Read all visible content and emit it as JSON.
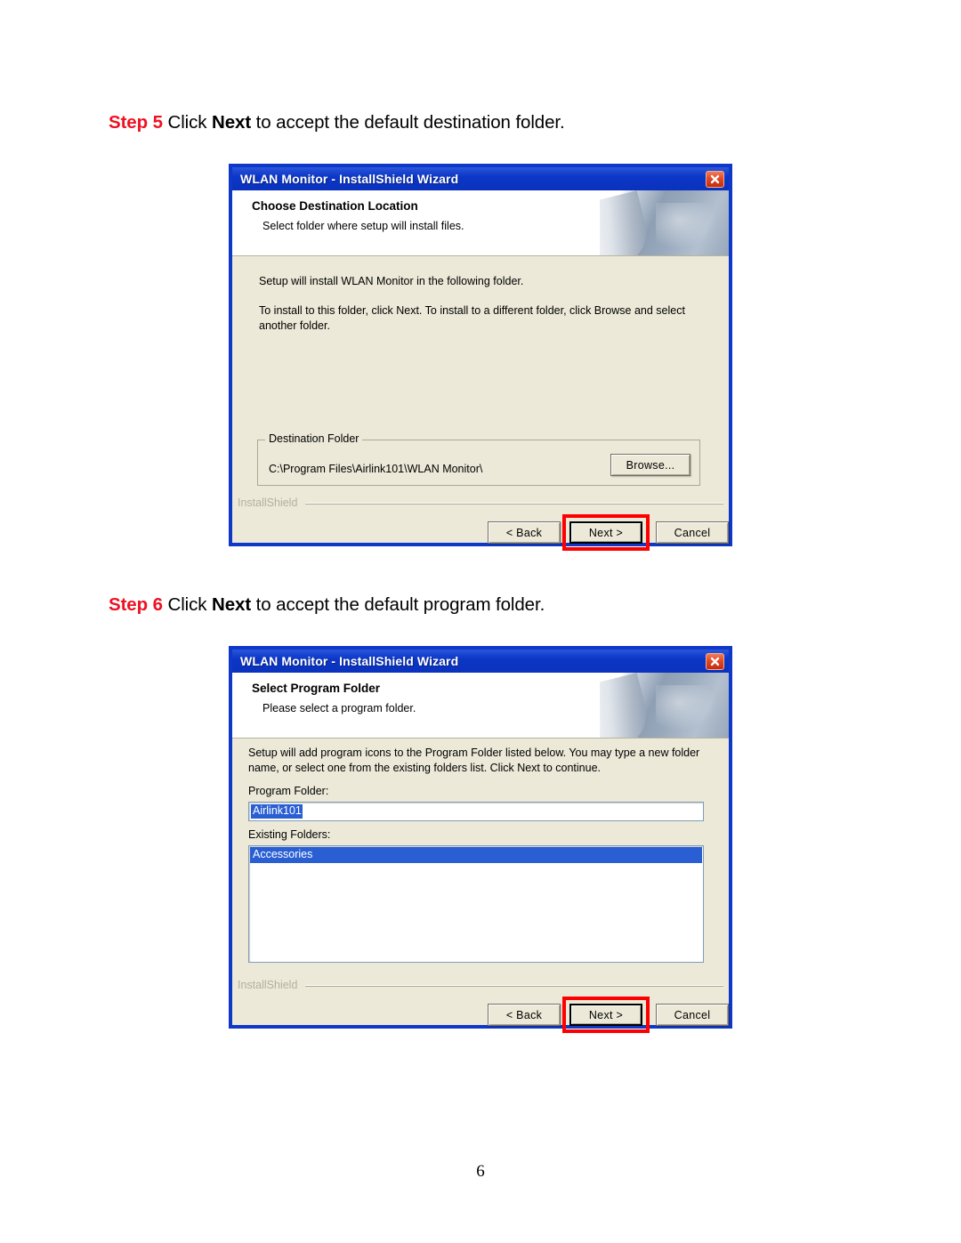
{
  "document": {
    "page_number": "6"
  },
  "steps": [
    {
      "label": "Step 5",
      "text_before": " Click ",
      "bold_word": "Next",
      "text_after": " to accept the default destination folder."
    },
    {
      "label": "Step 6",
      "text_before": " Click ",
      "bold_word": "Next",
      "text_after": " to accept the default program folder."
    }
  ],
  "dialog_destination": {
    "title": "WLAN Monitor - InstallShield Wizard",
    "close_icon": "close-icon",
    "header_title": "Choose Destination Location",
    "header_subtitle": "Select folder where setup will install files.",
    "body_paragraph_1": "Setup will install WLAN Monitor in the following folder.",
    "body_paragraph_2": "To install to this folder, click Next. To install to a different folder, click Browse and select another folder.",
    "groupbox_legend": "Destination Folder",
    "destination_path": "C:\\Program Files\\Airlink101\\WLAN Monitor\\",
    "browse_label": "Browse...",
    "installshield_label": "InstallShield",
    "back_label": "< Back",
    "next_label": "Next >",
    "cancel_label": "Cancel"
  },
  "dialog_program": {
    "title": "WLAN Monitor - InstallShield Wizard",
    "close_icon": "close-icon",
    "header_title": "Select Program Folder",
    "header_subtitle": "Please select a program folder.",
    "body_paragraph_1": "Setup will add program icons to the Program Folder listed below.  You may type a new folder name, or select one from the existing folders list.  Click Next to continue.",
    "program_folder_label": "Program Folder:",
    "program_folder_value": "Airlink101",
    "existing_folders_label": "Existing Folders:",
    "existing_folders": [
      "Accessories"
    ],
    "installshield_label": "InstallShield",
    "back_label": "< Back",
    "next_label": "Next >",
    "cancel_label": "Cancel"
  },
  "colors": {
    "step_label": "#ee1122",
    "titlebar_blue": "#0c36c6",
    "dialog_border": "#1038c8",
    "dialog_face": "#ece9d8",
    "highlight_red": "#ff0000",
    "selection_blue": "#2a5fd4"
  }
}
